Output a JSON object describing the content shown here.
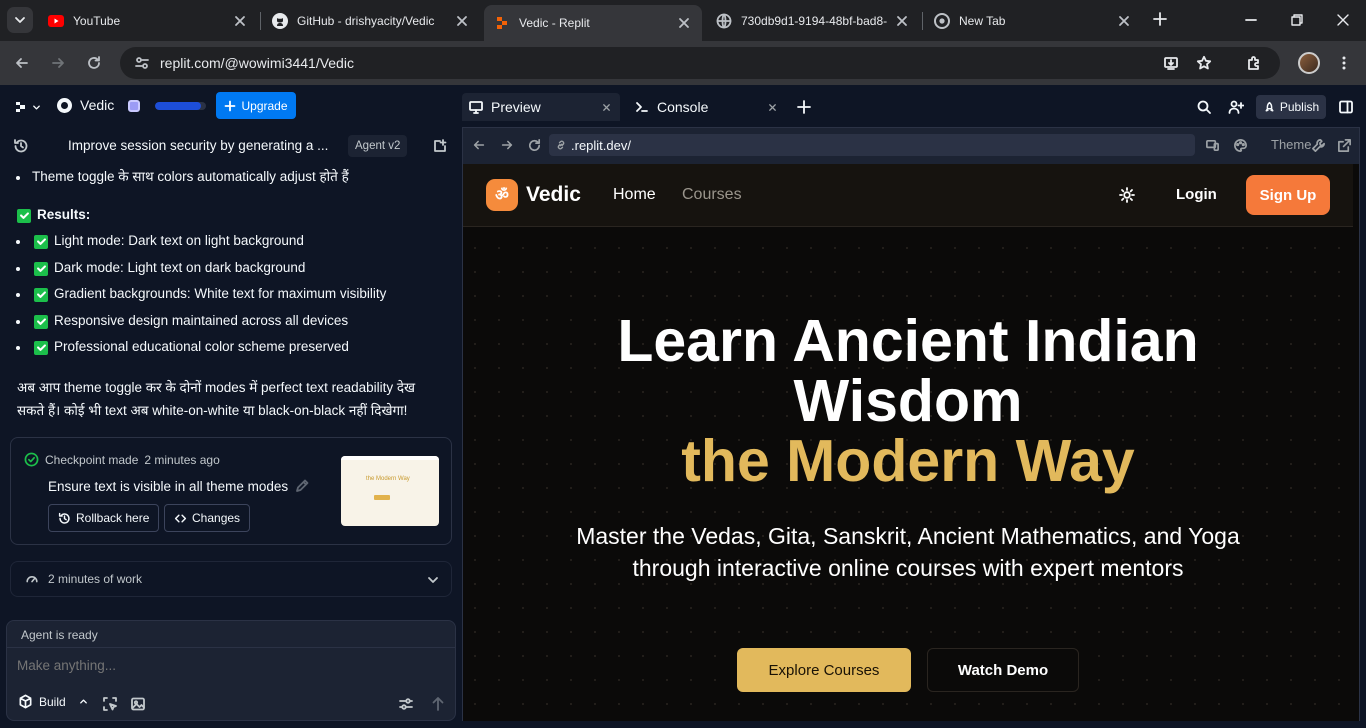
{
  "browser": {
    "tabs": [
      {
        "title": "YouTube",
        "icon": "youtube-icon"
      },
      {
        "title": "GitHub - drishyacity/Vedic",
        "icon": "github-icon"
      },
      {
        "title": "Vedic - Replit",
        "icon": "replit-icon",
        "active": true
      },
      {
        "title": "730db9d1-9194-48bf-bad8-",
        "icon": "globe-icon"
      },
      {
        "title": "New Tab",
        "icon": "chrome-icon"
      }
    ],
    "url": "replit.com/@wowimi3441/Vedic"
  },
  "replit": {
    "project_name": "Vedic",
    "upgrade_label": "Upgrade",
    "preview_tab": "Preview",
    "console_tab": "Console",
    "publish_label": "Publish",
    "usage_fraction": 0.9
  },
  "agent": {
    "thread_title": "Improve session security by generating a ...",
    "version_label": "Agent v2",
    "bullets_top": [
      "Theme toggle के साथ colors automatically adjust होते हैं"
    ],
    "results_label": "Results:",
    "results": [
      "Light mode: Dark text on light background",
      "Dark mode: Light text on dark background",
      "Gradient backgrounds: White text for maximum visibility",
      "Responsive design maintained across all devices",
      "Professional educational color scheme preserved"
    ],
    "summary_line1": "अब आप theme toggle कर के दोनों modes में perfect text readability देख",
    "summary_line2": "सकते हैं। कोई भी text अब white-on-white या black-on-black नहीं दिखेगा!",
    "checkpoint": {
      "status": "Checkpoint made",
      "time": "2 minutes ago",
      "description": "Ensure text is visible in all theme modes",
      "rollback_label": "Rollback here",
      "changes_label": "Changes",
      "thumb_title": "the Modern Way"
    },
    "work_summary": "2 minutes of work",
    "ready_label": "Agent is ready",
    "input_placeholder": "Make anything...",
    "build_label": "Build"
  },
  "preview": {
    "url": ".replit.dev/",
    "theme_label": "Theme"
  },
  "site": {
    "logo_glyph": "ॐ",
    "brand": "Vedic",
    "nav": [
      "Home",
      "Courses"
    ],
    "login": "Login",
    "signup": "Sign Up",
    "hero_line1": "Learn Ancient Indian",
    "hero_line2": "Wisdom",
    "hero_line3": "the Modern Way",
    "sub_line1": "Master the Vedas, Gita, Sanskrit, Ancient Mathematics, and Yoga",
    "sub_line2": "through interactive online courses with expert mentors",
    "explore": "Explore Courses",
    "demo": "Watch Demo",
    "accent_color": "#e2b95c",
    "signup_color": "#f5793a"
  }
}
